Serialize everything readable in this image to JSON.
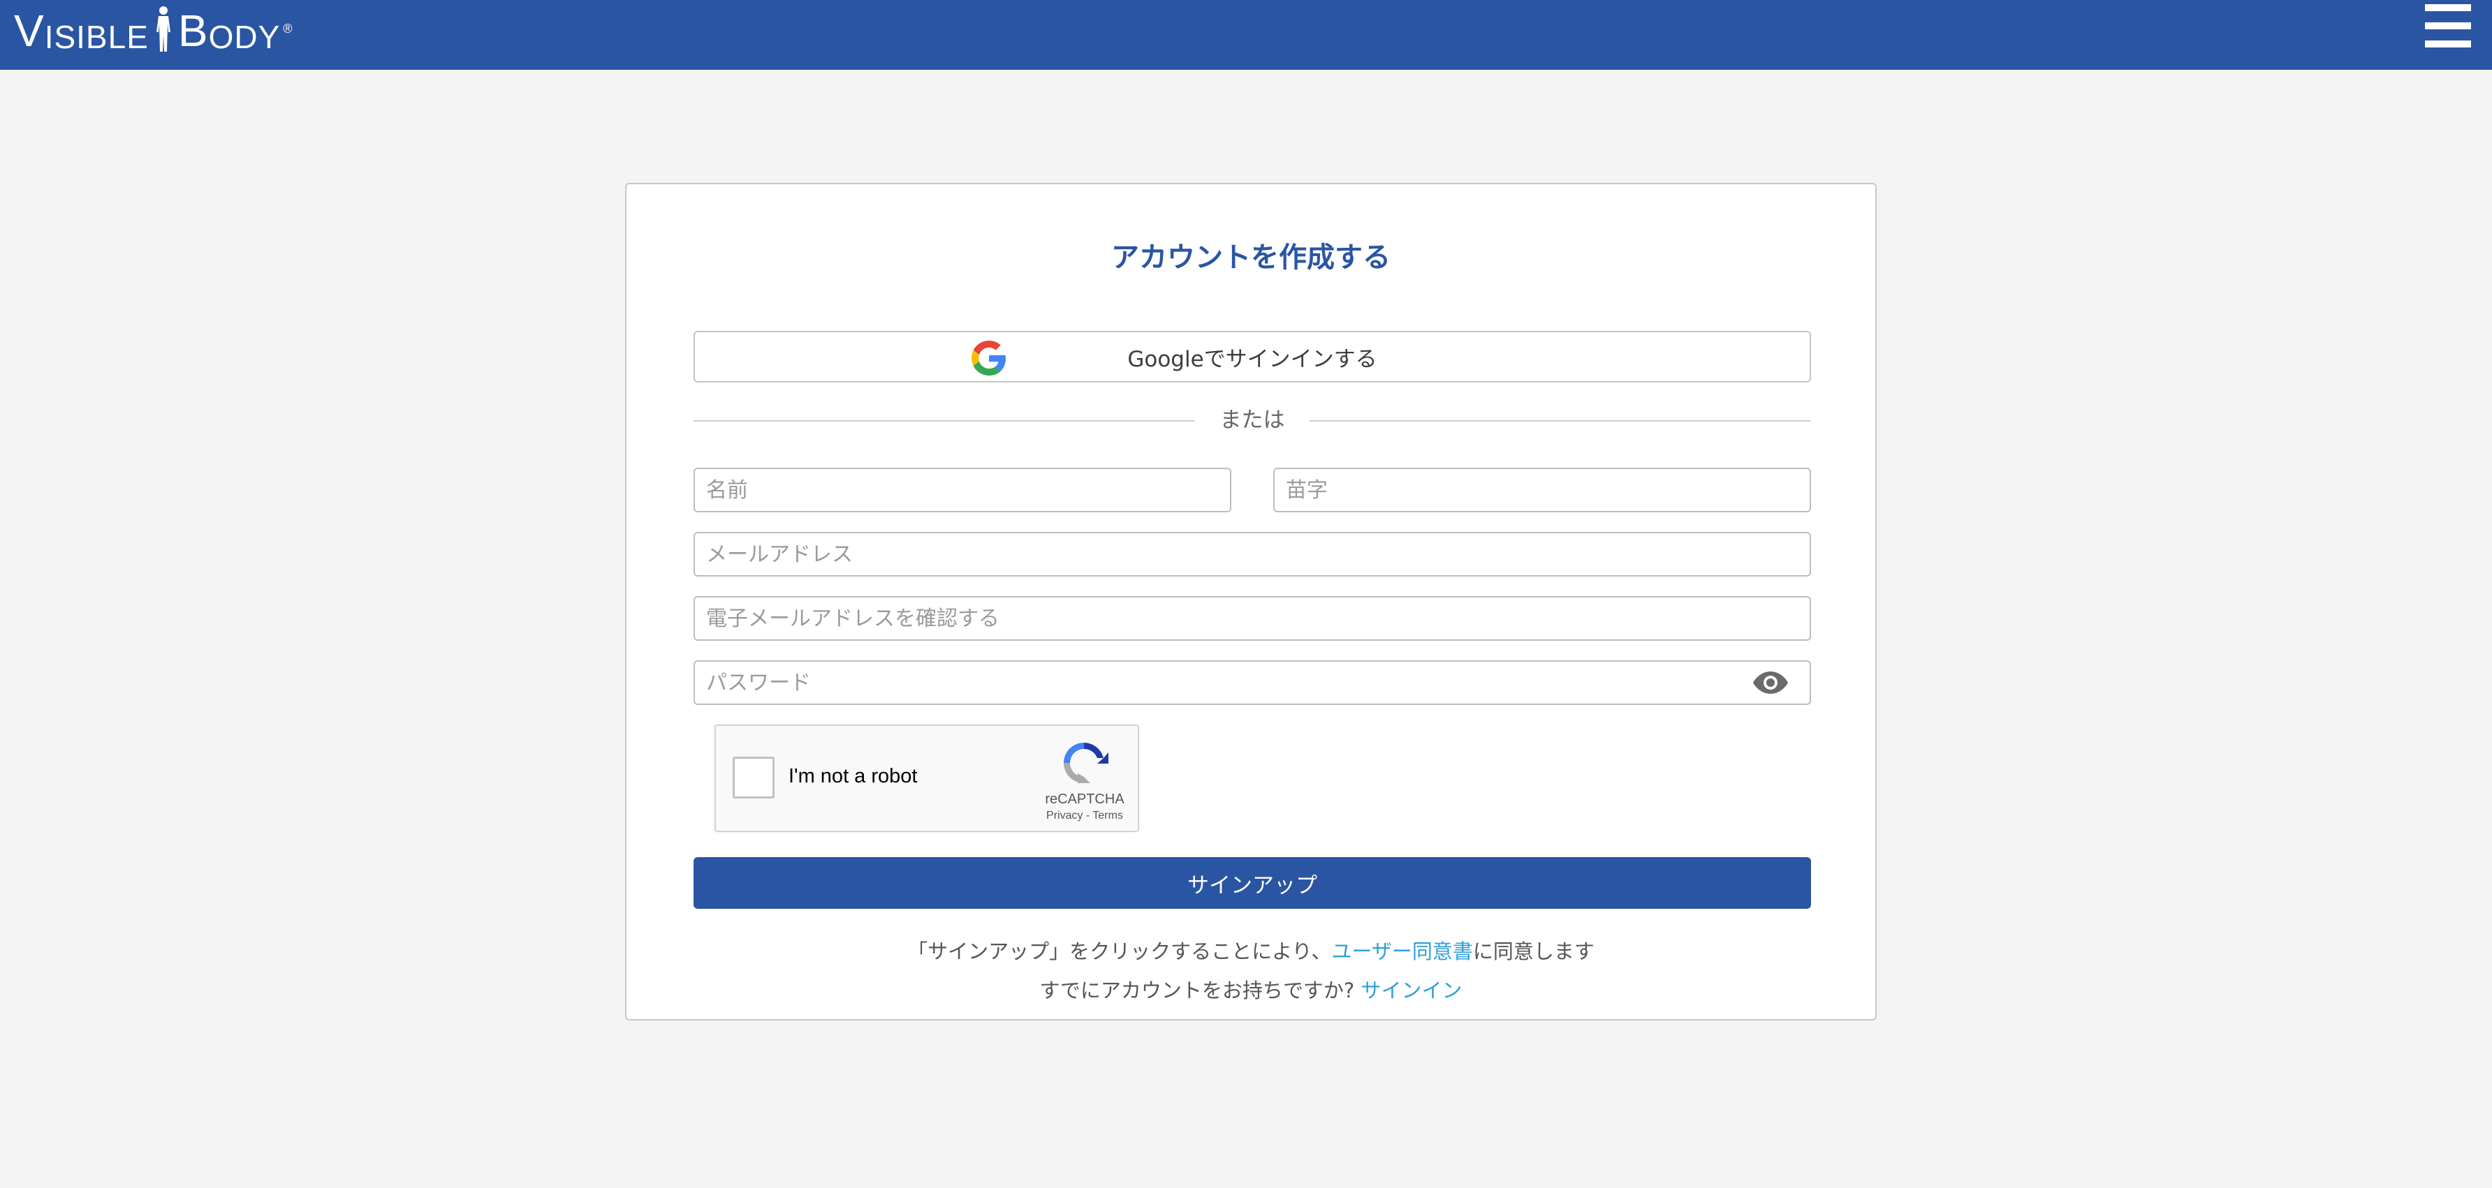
{
  "header": {
    "logo": {
      "part1_initial": "V",
      "part1_rest": "ISIBLE",
      "part2_initial": "B",
      "part2_rest": "ODY",
      "registered": "®"
    },
    "menu_icon": "hamburger-icon",
    "background_color": "#2a55a3"
  },
  "form": {
    "title": "アカウントを作成する",
    "google_button_label": "Googleでサインインする",
    "google_icon": "google-g-icon",
    "divider_text": "または",
    "fields": {
      "first_name_placeholder": "名前",
      "last_name_placeholder": "苗字",
      "email_placeholder": "メールアドレス",
      "confirm_email_placeholder": "電子メールアドレスを確認する",
      "password_placeholder": "パスワード"
    },
    "password_toggle_icon": "eye-icon",
    "captcha": {
      "label": "I'm not a robot",
      "brand": "reCAPTCHA",
      "privacy": "Privacy",
      "separator": " - ",
      "terms": "Terms",
      "icon": "recaptcha-icon"
    },
    "signup_button_label": "サインアップ",
    "agreement": {
      "prefix": "「サインアップ」をクリックすることにより、",
      "link": "ユーザー同意書",
      "suffix": "に同意します"
    },
    "signin_prompt": {
      "text": "すでにアカウントをお持ちですか? ",
      "link": "サインイン"
    }
  },
  "colors": {
    "accent": "#2a55a3",
    "link": "#2e9fd8",
    "page_background": "#f4f4f4"
  }
}
